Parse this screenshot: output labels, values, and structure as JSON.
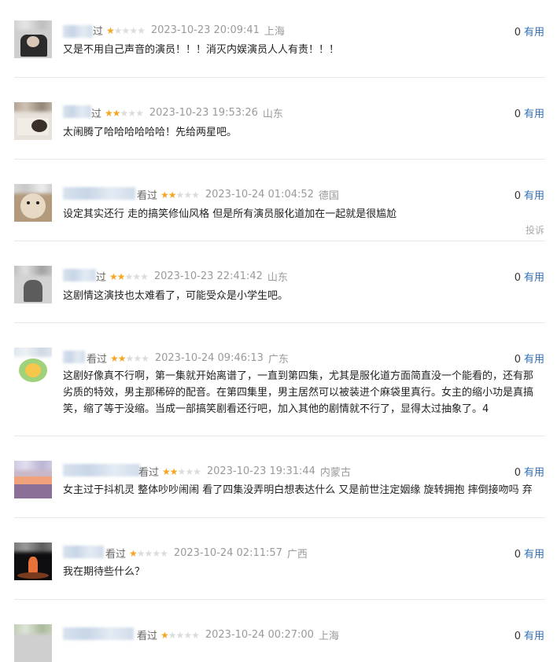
{
  "ui": {
    "useful_label": "有用",
    "watched_label": "看过",
    "report_label": "投诉"
  },
  "comments": [
    {
      "rating": 1,
      "time": "2023-10-23 20:09:41",
      "location": "上海",
      "useful_count": "0",
      "text": "又是不用自己声音的演员！！！消灭内娱演员人人有责！！！",
      "watched_partial": "过"
    },
    {
      "rating": 2,
      "time": "2023-10-23 19:53:26",
      "location": "山东",
      "useful_count": "0",
      "text": "太闹腾了哈哈哈哈哈哈！先给两星吧。",
      "watched_partial": "过"
    },
    {
      "rating": 2,
      "time": "2023-10-24 01:04:52",
      "location": "德国",
      "useful_count": "0",
      "text": "设定其实还行 走的搞笑修仙风格 但是所有演员服化道加在一起就是很尴尬",
      "watched_partial": "看过"
    },
    {
      "rating": 2,
      "time": "2023-10-23 22:41:42",
      "location": "山东",
      "useful_count": "0",
      "text": "这剧情这演技也太难看了，可能受众是小学生吧。",
      "watched_partial": "过"
    },
    {
      "rating": 2,
      "time": "2023-10-24 09:46:13",
      "location": "广东",
      "useful_count": "0",
      "text": "这剧好像真不行啊，第一集就开始离谱了，一直到第四集，尤其是服化道方面简直没一个能看的，还有那劣质的特效，男主那稀碎的配音。在第四集里，男主居然可以被装进个麻袋里真行。女主的缩小功是真搞笑，缩了等于没缩。当成一部搞笑剧看还行吧，加入其他的剧情就不行了，显得太过抽象了。4",
      "watched_partial": "看过"
    },
    {
      "rating": 2,
      "time": "2023-10-23 19:31:44",
      "location": "内蒙古",
      "useful_count": "0",
      "text": "女主过于抖机灵 整体吵吵闹闹 看了四集没弄明白想表达什么 又是前世注定姻缘 旋转拥抱 摔倒接吻吗 弃",
      "watched_partial": "看过"
    },
    {
      "rating": 1,
      "time": "2023-10-24 02:11:57",
      "location": "广西",
      "useful_count": "0",
      "text": "我在期待些什么？",
      "watched_partial": "看过"
    },
    {
      "rating": 1,
      "time": "2023-10-24 00:27:00",
      "location": "上海",
      "useful_count": "0",
      "text": "",
      "watched_partial": "看过"
    }
  ]
}
